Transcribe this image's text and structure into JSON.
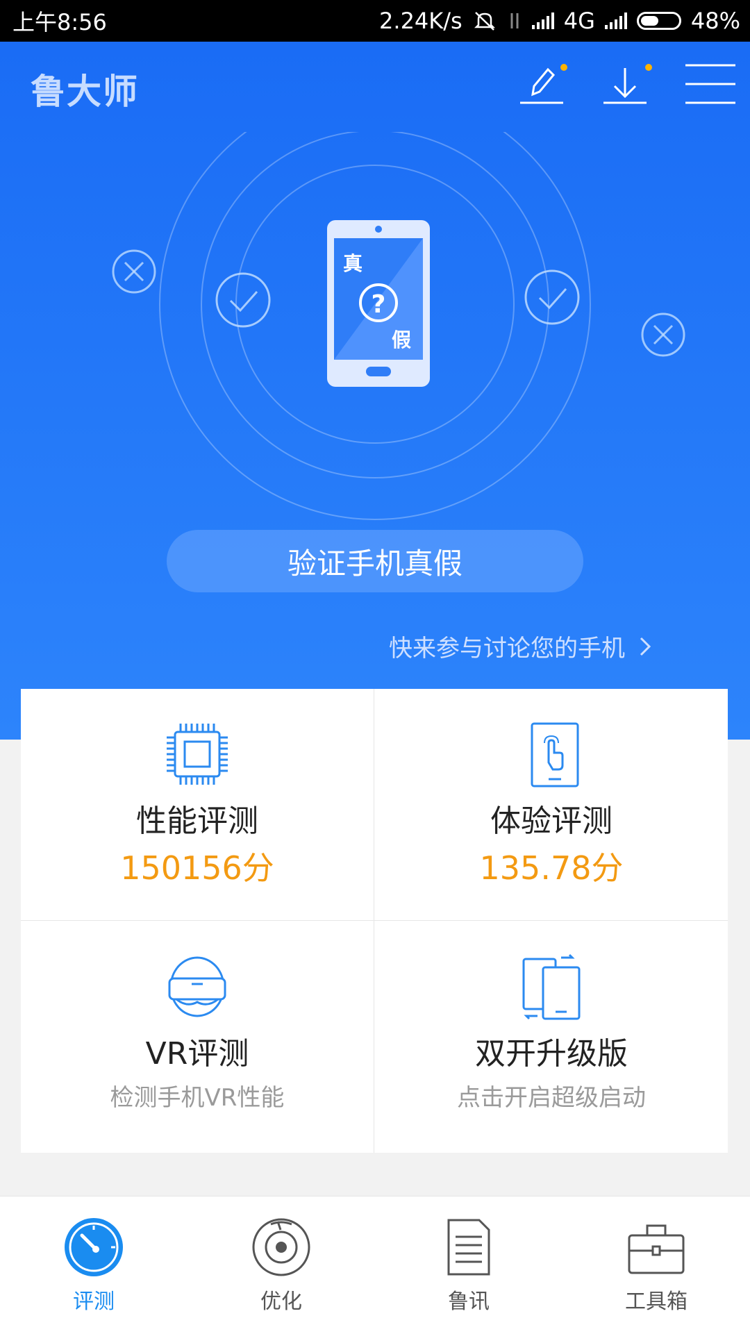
{
  "status_bar": {
    "time": "上午8:56",
    "speed": "2.24K/s",
    "network": "4G",
    "battery": "48%",
    "battery_level": 0.48
  },
  "header": {
    "logo": "鲁大师",
    "icons": [
      "edit-icon",
      "download-icon",
      "menu-icon"
    ]
  },
  "hero": {
    "phone_text_real": "真",
    "phone_text_fake": "假",
    "verify_button": "验证手机真假",
    "discuss_link": "快来参与讨论您的手机"
  },
  "grid": {
    "performance": {
      "title": "性能评测",
      "score": "150156分",
      "icon": "chip-icon"
    },
    "experience": {
      "title": "体验评测",
      "score": "135.78分",
      "icon": "touch-phone-icon"
    },
    "vr": {
      "title": "VR评测",
      "subtitle": "检测手机VR性能",
      "icon": "vr-headset-icon"
    },
    "dual": {
      "title": "双开升级版",
      "subtitle": "点击开启超级启动",
      "icon": "dual-phone-icon"
    }
  },
  "tabs": [
    {
      "label": "评测",
      "icon": "speedometer-icon",
      "active": true
    },
    {
      "label": "优化",
      "icon": "disc-icon",
      "active": false
    },
    {
      "label": "鲁讯",
      "icon": "document-icon",
      "active": false
    },
    {
      "label": "工具箱",
      "icon": "toolbox-icon",
      "active": false
    }
  ],
  "colors": {
    "primary": "#1a6cf5",
    "accent": "#f39a12",
    "active_tab": "#1a8cf0"
  }
}
